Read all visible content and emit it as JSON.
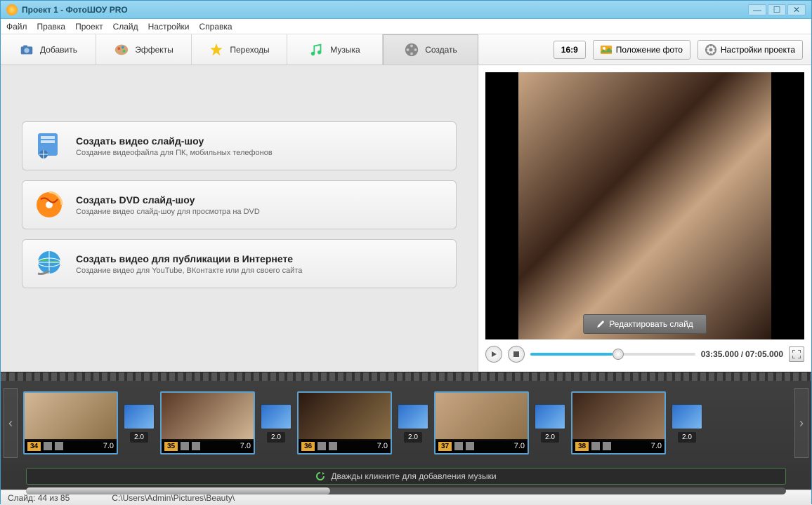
{
  "window": {
    "title": "Проект 1 - ФотоШОУ PRO"
  },
  "menu": {
    "file": "Файл",
    "edit": "Правка",
    "project": "Проект",
    "slide": "Слайд",
    "settings": "Настройки",
    "help": "Справка"
  },
  "tabs": {
    "add": "Добавить",
    "effects": "Эффекты",
    "transitions": "Переходы",
    "music": "Музыка",
    "create": "Создать"
  },
  "toolbar": {
    "ratio": "16:9",
    "photo_position": "Положение фото",
    "project_settings": "Настройки проекта"
  },
  "cards": {
    "video": {
      "title": "Создать видео слайд-шоу",
      "desc": "Создание видеофайла для ПК, мобильных телефонов"
    },
    "dvd": {
      "title": "Создать DVD слайд-шоу",
      "desc": "Создание видео слайд-шоу для просмотра на DVD"
    },
    "web": {
      "title": "Создать видео для публикации в Интернете",
      "desc": "Создание видео для YouTube, ВКонтакте или для своего сайта"
    }
  },
  "preview": {
    "edit_label": "Редактировать слайд"
  },
  "player": {
    "current": "03:35.000",
    "total": "07:05.000"
  },
  "slides": [
    {
      "num": "34",
      "dur": "7.0"
    },
    {
      "num": "35",
      "dur": "7.0"
    },
    {
      "num": "36",
      "dur": "7.0"
    },
    {
      "num": "37",
      "dur": "7.0"
    },
    {
      "num": "38",
      "dur": "7.0"
    }
  ],
  "transitions": [
    {
      "dur": "2.0"
    },
    {
      "dur": "2.0"
    },
    {
      "dur": "2.0"
    },
    {
      "dur": "2.0"
    },
    {
      "dur": "2.0"
    }
  ],
  "music_hint": "Дважды кликните для добавления музыки",
  "status": {
    "slide": "Слайд: 44 из 85",
    "path": "C:\\Users\\Admin\\Pictures\\Beauty\\"
  }
}
